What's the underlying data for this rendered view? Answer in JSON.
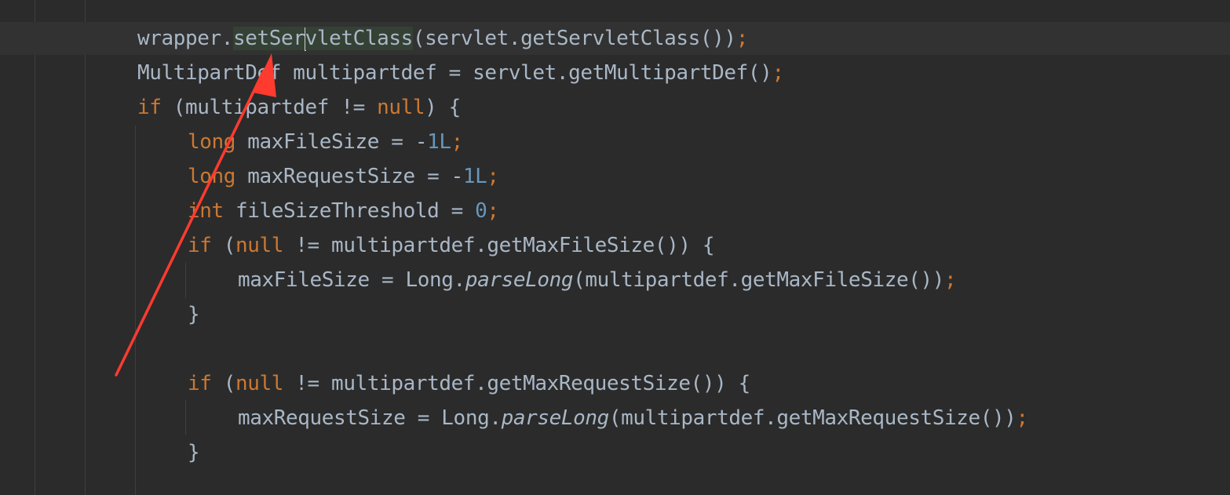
{
  "editor": {
    "lines": [
      {
        "indent": 0,
        "tokens": [
          {
            "t": "wrapper."
          },
          {
            "t": "setSer",
            "c": "hl"
          },
          {
            "caret": true
          },
          {
            "t": "vletClass",
            "c": "hl"
          },
          {
            "t": "(servlet.getServletClass())"
          },
          {
            "t": ";",
            "c": "semi"
          }
        ]
      },
      {
        "indent": 0,
        "tokens": [
          {
            "t": "MultipartDef multipartdef = servlet.getMultipartDef()"
          },
          {
            "t": ";",
            "c": "semi"
          }
        ]
      },
      {
        "indent": 0,
        "tokens": [
          {
            "t": "if",
            "c": "kw"
          },
          {
            "t": " (multipartdef != "
          },
          {
            "t": "null",
            "c": "kw"
          },
          {
            "t": ") {"
          }
        ]
      },
      {
        "indent": 1,
        "tokens": [
          {
            "t": "long",
            "c": "kw"
          },
          {
            "t": " maxFileSize = -"
          },
          {
            "t": "1L",
            "c": "num"
          },
          {
            "t": ";",
            "c": "semi"
          }
        ]
      },
      {
        "indent": 1,
        "tokens": [
          {
            "t": "long",
            "c": "kw"
          },
          {
            "t": " maxRequestSize = -"
          },
          {
            "t": "1L",
            "c": "num"
          },
          {
            "t": ";",
            "c": "semi"
          }
        ]
      },
      {
        "indent": 1,
        "tokens": [
          {
            "t": "int",
            "c": "kw"
          },
          {
            "t": " fileSizeThreshold = "
          },
          {
            "t": "0",
            "c": "num"
          },
          {
            "t": ";",
            "c": "semi"
          }
        ]
      },
      {
        "indent": 1,
        "tokens": [
          {
            "t": "if",
            "c": "kw"
          },
          {
            "t": " ("
          },
          {
            "t": "null",
            "c": "kw"
          },
          {
            "t": " != multipartdef.getMaxFileSize()) {"
          }
        ]
      },
      {
        "indent": 2,
        "tokens": [
          {
            "t": "maxFileSize = Long."
          },
          {
            "t": "parseLong",
            "c": "it"
          },
          {
            "t": "(multipartdef.getMaxFileSize())"
          },
          {
            "t": ";",
            "c": "semi"
          }
        ]
      },
      {
        "indent": 1,
        "tokens": [
          {
            "t": "}"
          }
        ]
      },
      {
        "indent": 1,
        "tokens": []
      },
      {
        "indent": 1,
        "tokens": [
          {
            "t": "if",
            "c": "kw"
          },
          {
            "t": " ("
          },
          {
            "t": "null",
            "c": "kw"
          },
          {
            "t": " != multipartdef.getMaxRequestSize()) {"
          }
        ]
      },
      {
        "indent": 2,
        "tokens": [
          {
            "t": "maxRequestSize = Long."
          },
          {
            "t": "parseLong",
            "c": "it"
          },
          {
            "t": "(multipartdef.getMaxRequestSize())"
          },
          {
            "t": ";",
            "c": "semi"
          }
        ]
      },
      {
        "indent": 1,
        "tokens": [
          {
            "t": "}"
          }
        ]
      }
    ]
  },
  "annotation": {
    "type": "arrow",
    "color": "#ff3b30",
    "icon": "red-arrow-annotation-icon"
  },
  "colors": {
    "background": "#2b2b2b",
    "current_line": "#323232",
    "keyword": "#cc7832",
    "number": "#6897bb",
    "identifier": "#a9b7c6",
    "highlight": "#344134"
  }
}
